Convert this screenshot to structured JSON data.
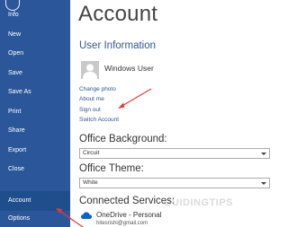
{
  "sidebar": {
    "items": [
      {
        "label": "Info"
      },
      {
        "label": "New"
      },
      {
        "label": "Open"
      },
      {
        "label": "Save"
      },
      {
        "label": "Save As"
      },
      {
        "label": "Print"
      },
      {
        "label": "Share"
      },
      {
        "label": "Export"
      },
      {
        "label": "Close"
      },
      {
        "label": "Account"
      },
      {
        "label": "Options"
      }
    ],
    "active": "Account",
    "background": "#2b579a"
  },
  "main": {
    "title": "Account",
    "user_info": {
      "heading": "User Information",
      "user_name": "Windows User",
      "links": {
        "change_photo": "Change photo",
        "about_me": "About me",
        "sign_out": "Sign out",
        "switch_account": "Switch Account"
      }
    },
    "office_background": {
      "label": "Office Background:",
      "value": "Circuit"
    },
    "office_theme": {
      "label": "Office Theme:",
      "value": "White"
    },
    "connected_services": {
      "label": "Connected Services:",
      "service_name": "OneDrive - Personal",
      "service_email": "hitesrishi@gmail.com"
    }
  },
  "watermark": "GUIDINGTIPS",
  "annotation_color": "#e53935",
  "accent_color": "#2b579a"
}
